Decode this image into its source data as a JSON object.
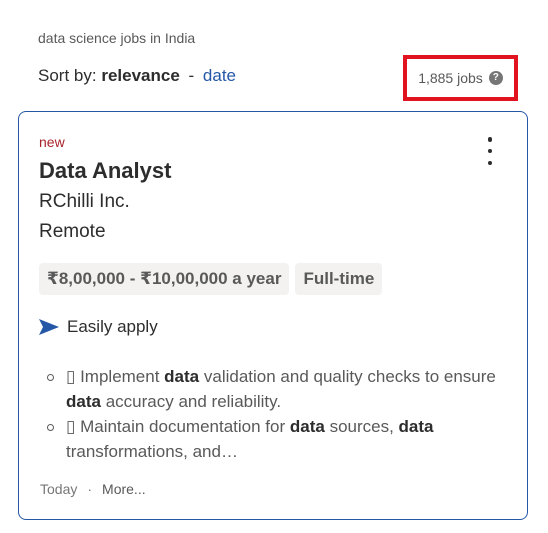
{
  "breadcrumb": "data science jobs in India",
  "sort": {
    "prefix": "Sort by:",
    "active": "relevance",
    "separator": "-",
    "alternative": "date"
  },
  "job_count": {
    "text": "1,885 jobs",
    "help_glyph": "?"
  },
  "highlight_color": "#e0131f",
  "card": {
    "new_label": "new",
    "title": "Data Analyst",
    "company": "RChilli Inc.",
    "location": "Remote",
    "chips": [
      "₹8,00,000 - ₹10,00,000 a year",
      "Full-time"
    ],
    "easy_apply": "Easily apply",
    "snippet": [
      {
        "parts": [
          "▯ Implement ",
          "data",
          " validation and quality checks to ensure ",
          "data",
          " accuracy and reliability."
        ]
      },
      {
        "parts": [
          "▯ Maintain documentation for ",
          "data",
          " sources, ",
          "data",
          " transformations, and…"
        ]
      }
    ],
    "posted": "Today",
    "dot": "·",
    "more": "More..."
  }
}
